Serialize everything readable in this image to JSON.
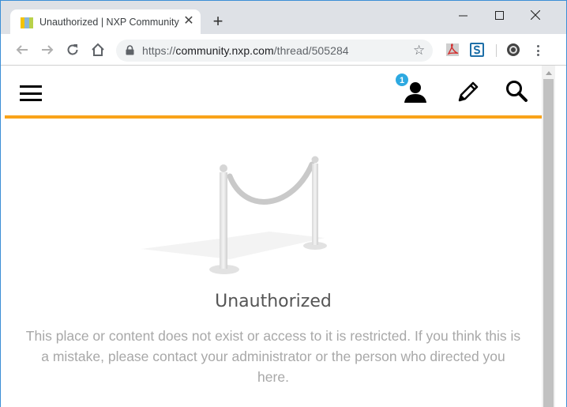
{
  "browser": {
    "tab": {
      "title": "Unauthorized | NXP Community",
      "favicon": "nxp-favicon",
      "close_icon": "close-icon"
    },
    "new_tab_icon": "plus-icon",
    "window_controls": [
      "minimize-icon",
      "maximize-icon",
      "close-icon"
    ],
    "url": {
      "scheme": "https://",
      "host": "community.nxp.com",
      "path": "/thread/505284"
    },
    "extensions": [
      "pdf-extension-icon",
      "s-extension-icon",
      "record-extension-icon"
    ]
  },
  "site": {
    "notification_count": "1",
    "accent_color": "#f9a31a",
    "icons": [
      "hamburger-menu-icon",
      "user-icon",
      "pencil-icon",
      "search-icon"
    ]
  },
  "error": {
    "title": "Unauthorized",
    "message": "This place or content does not exist or access to it is restricted. If you think this is a mistake, please contact your administrator or the person who directed you here."
  }
}
